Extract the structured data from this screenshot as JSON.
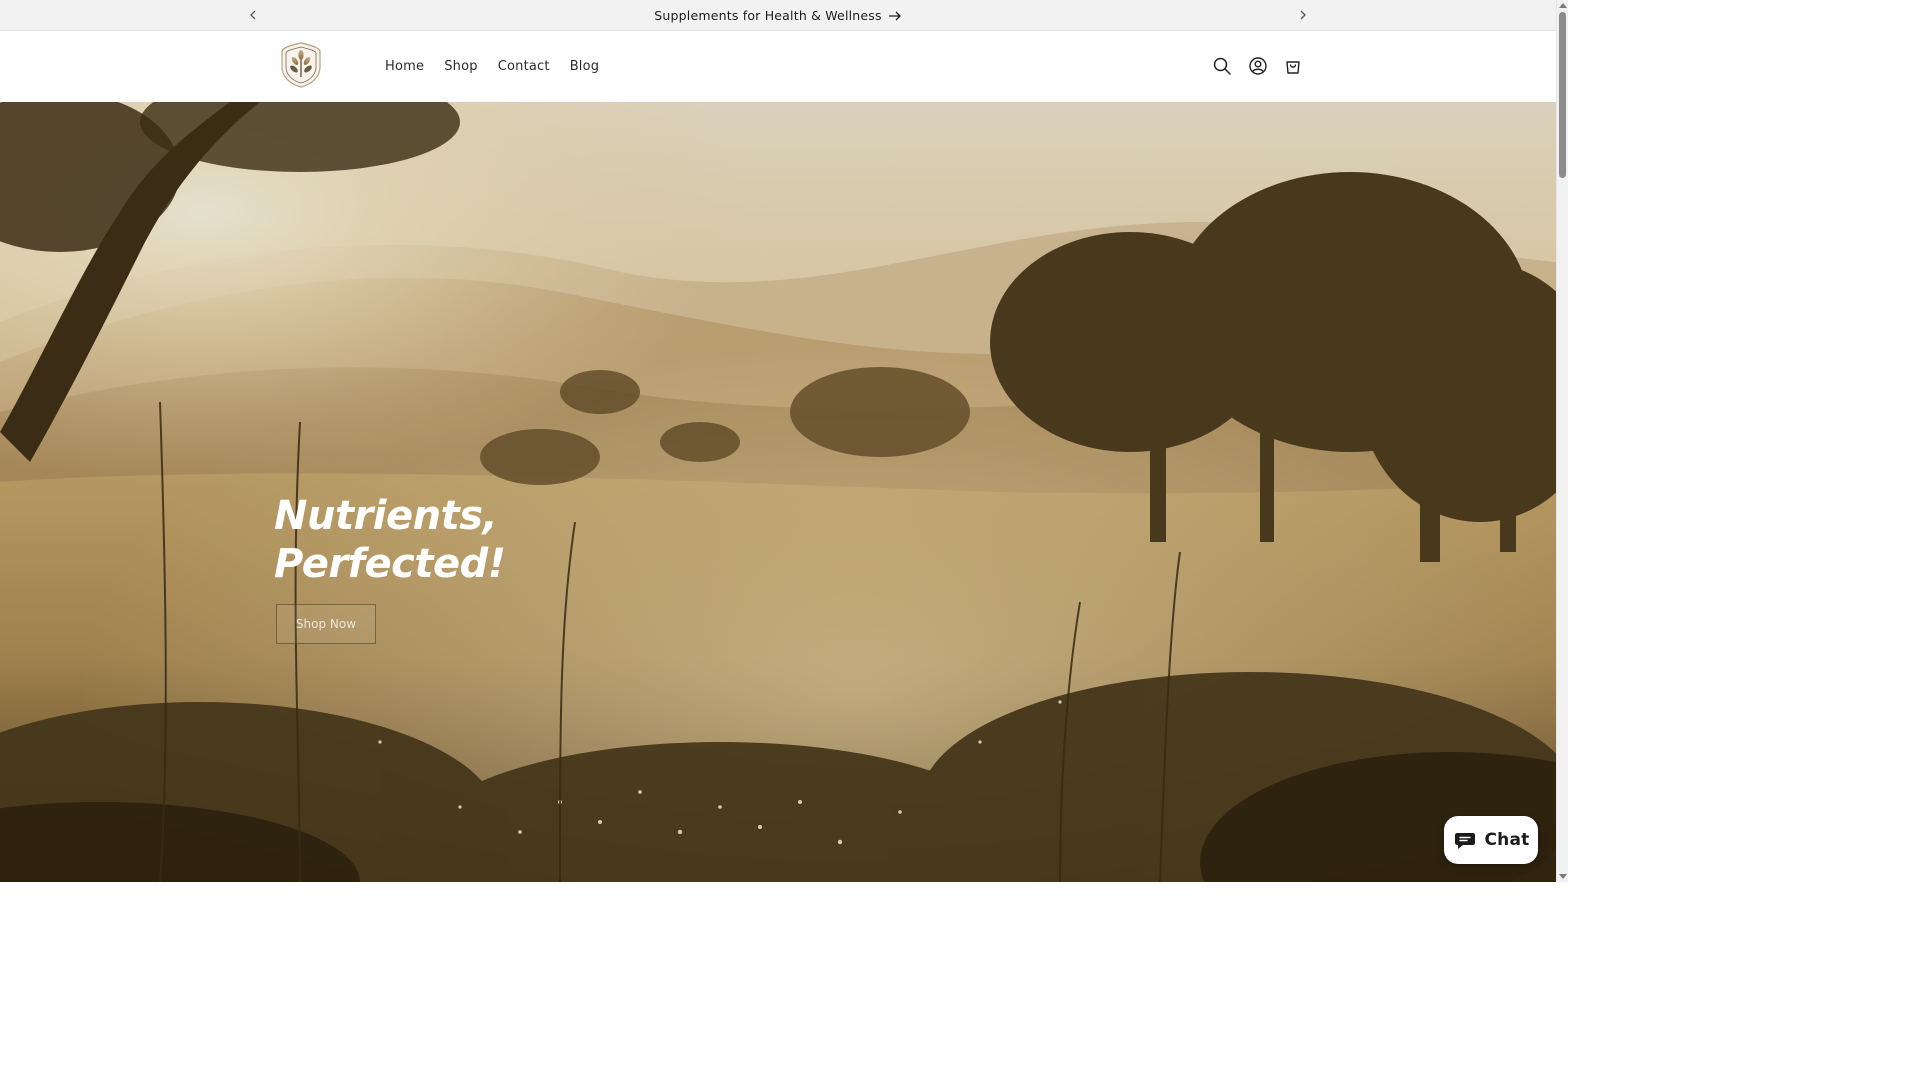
{
  "announcement": {
    "text": "Supplements for Health & Wellness",
    "prev_icon": "chevron-left-icon",
    "next_icon": "chevron-right-icon",
    "arrow_icon": "arrow-right-icon"
  },
  "header": {
    "logo_icon": "leaf-crest-logo",
    "nav": [
      {
        "label": "Home"
      },
      {
        "label": "Shop"
      },
      {
        "label": "Contact"
      },
      {
        "label": "Blog"
      }
    ],
    "icons": [
      "search-icon",
      "account-icon",
      "cart-icon"
    ]
  },
  "hero": {
    "title": "Nutrients,\nPerfected!",
    "button_label": "Shop Now"
  },
  "chat": {
    "label": "Chat",
    "icon": "chat-bubble-icon"
  },
  "colors": {
    "announcement_bg": "#f2f2f2",
    "header_bg": "#ffffff",
    "hero_title": "#ffffff",
    "text": "#1c1c1c"
  }
}
